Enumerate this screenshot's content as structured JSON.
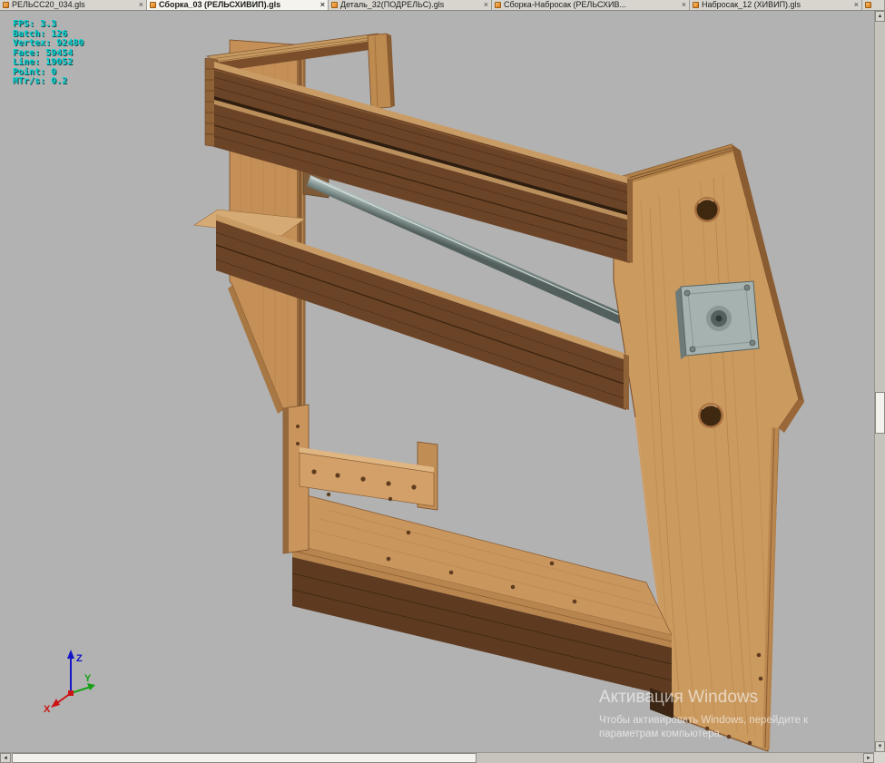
{
  "tabs": [
    {
      "label": "РЕЛЬСС20_034.gls",
      "active": false
    },
    {
      "label": "Сборка_03 (РЕЛЬСХИВИП).gls",
      "active": true
    },
    {
      "label": "Деталь_32(ПОДРЕЛЬС).gls",
      "active": false
    },
    {
      "label": "Сборка-Набросак (РЕЛЬСХИВ...",
      "active": false
    },
    {
      "label": "Набросак_12 (ХИВИП).gls",
      "active": false
    }
  ],
  "ui": {
    "close_glyph": "×",
    "icons": {
      "up": "▲",
      "down": "▼",
      "left": "◄",
      "right": "►"
    }
  },
  "stats": [
    "FPS: 3.3",
    "Batch: 126",
    "Vertex: 92480",
    "Face: 59454",
    "Line: 19052",
    "Point: 0",
    "MTr/s: 0.2"
  ],
  "axes": {
    "x_label": "X",
    "y_label": "Y",
    "z_label": "Z"
  },
  "watermark": {
    "title": "Активация Windows",
    "line1": "Чтобы активировать Windows, перейдите к",
    "line2": "параметрам компьютера."
  },
  "scene": {
    "description": "Wooden CNC machine frame assembly: side panels, stacked rails, drive rod and stepper motor, bottom shelf",
    "colors": {
      "background": "#b2b2b2",
      "wood_light": "#cb9a5f",
      "wood_dark": "#6b4326",
      "metal_rod": "#90a19e",
      "motor_gray": "#a6b2b0",
      "stats_text": "#00d2d2"
    }
  }
}
